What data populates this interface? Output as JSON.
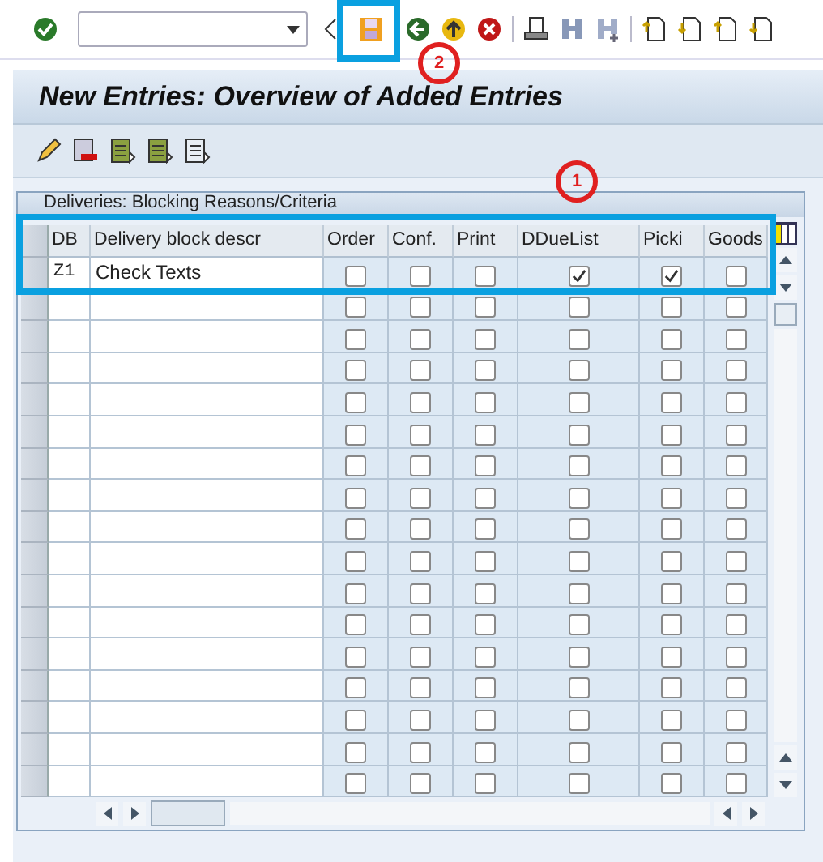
{
  "title": "New Entries: Overview of Added Entries",
  "table": {
    "title": "Deliveries: Blocking Reasons/Criteria",
    "columns": [
      "DB",
      "Delivery block descr",
      "Order",
      "Conf.",
      "Print",
      "DDueList",
      "Picki",
      "Goods"
    ],
    "rows": [
      {
        "db": "Z1",
        "description": "Check Texts",
        "checks": [
          false,
          false,
          false,
          true,
          true,
          false
        ]
      },
      {
        "checks": [
          false,
          false,
          false,
          false,
          false,
          false
        ]
      },
      {
        "checks": [
          false,
          false,
          false,
          false,
          false,
          false
        ]
      },
      {
        "checks": [
          false,
          false,
          false,
          false,
          false,
          false
        ]
      },
      {
        "checks": [
          false,
          false,
          false,
          false,
          false,
          false
        ]
      },
      {
        "checks": [
          false,
          false,
          false,
          false,
          false,
          false
        ]
      },
      {
        "checks": [
          false,
          false,
          false,
          false,
          false,
          false
        ]
      },
      {
        "checks": [
          false,
          false,
          false,
          false,
          false,
          false
        ]
      },
      {
        "checks": [
          false,
          false,
          false,
          false,
          false,
          false
        ]
      },
      {
        "checks": [
          false,
          false,
          false,
          false,
          false,
          false
        ]
      },
      {
        "checks": [
          false,
          false,
          false,
          false,
          false,
          false
        ]
      },
      {
        "checks": [
          false,
          false,
          false,
          false,
          false,
          false
        ]
      },
      {
        "checks": [
          false,
          false,
          false,
          false,
          false,
          false
        ]
      },
      {
        "checks": [
          false,
          false,
          false,
          false,
          false,
          false
        ]
      },
      {
        "checks": [
          false,
          false,
          false,
          false,
          false,
          false
        ]
      },
      {
        "checks": [
          false,
          false,
          false,
          false,
          false,
          false
        ]
      },
      {
        "checks": [
          false,
          false,
          false,
          false,
          false,
          false
        ]
      }
    ]
  },
  "annotations": [
    {
      "label": "1"
    },
    {
      "label": "2"
    }
  ]
}
